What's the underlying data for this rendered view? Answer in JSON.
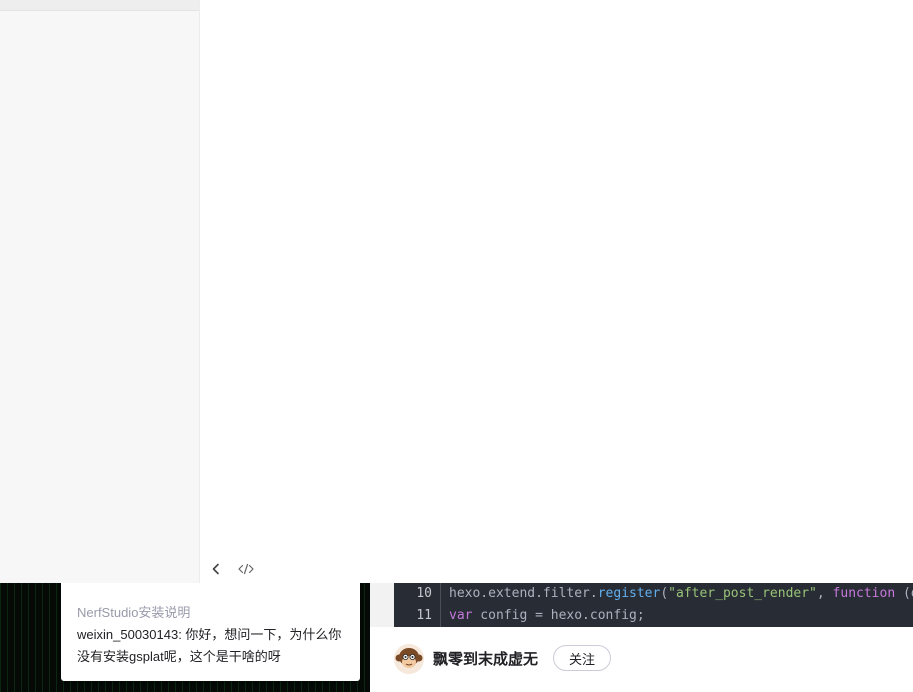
{
  "toolbar": {
    "back_icon": "chevron-left-icon",
    "code_icon": "code-icon"
  },
  "comment": {
    "article_title": "NerfStudio安装说明",
    "text": "weixin_50030143: 你好，想问一下，为什么你没有安装gsplat呢，这个是干啥的呀"
  },
  "code": {
    "lines": [
      {
        "number": "10",
        "text": "hexo.extend.filter.register(\"after_post_render\", function (da"
      },
      {
        "number": "11",
        "text": "var config = hexo.config;"
      }
    ]
  },
  "author": {
    "name": "飘零到末成虚无",
    "follow_label": "关注"
  },
  "colors": {
    "code_bg": "#282c34",
    "sidebar_bg": "#f7f7f7"
  }
}
